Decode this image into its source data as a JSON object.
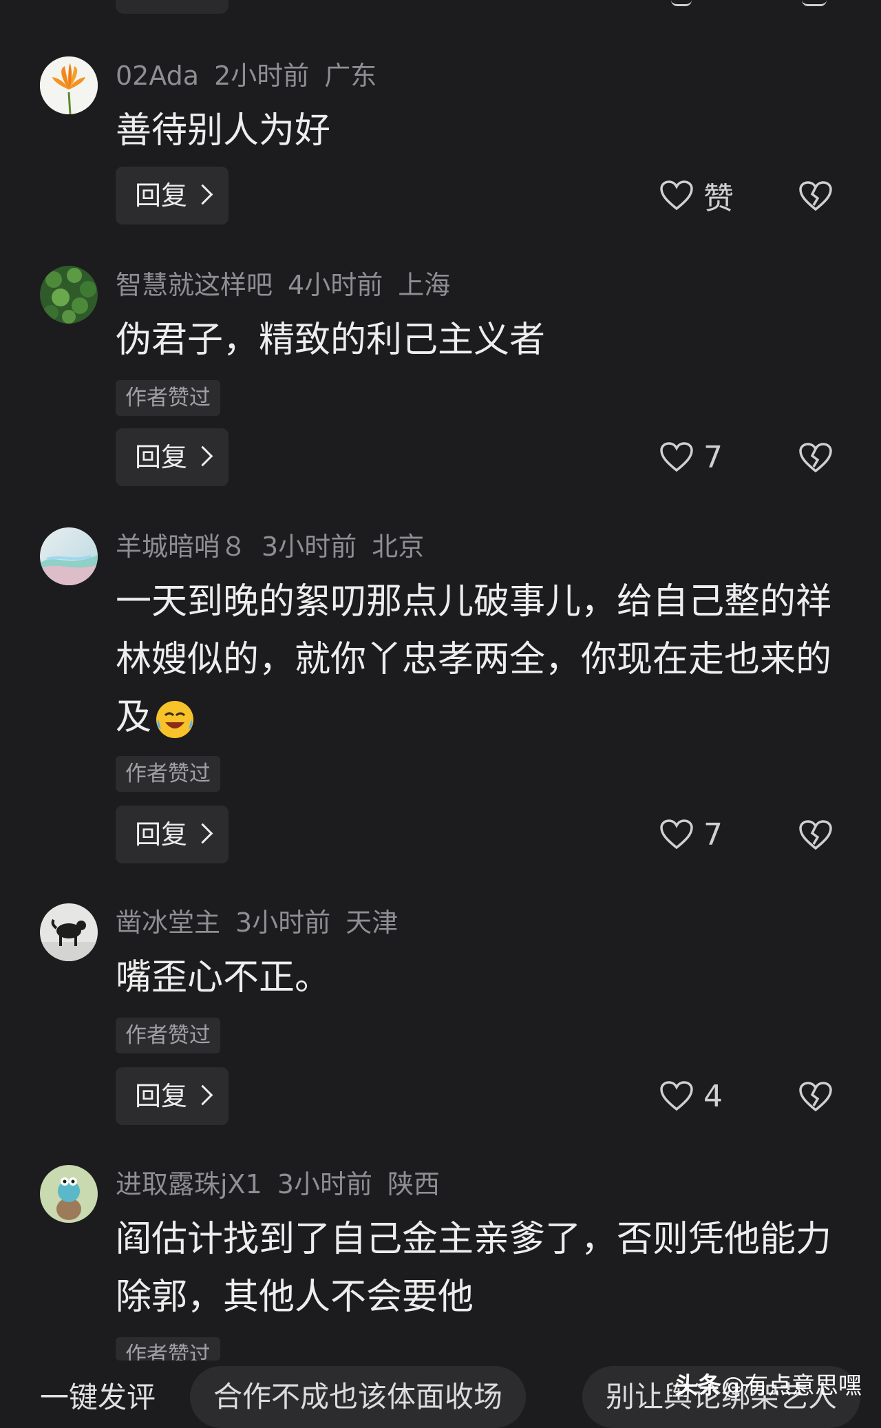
{
  "comments": [
    {
      "user": "02Ada",
      "time": "2小时前",
      "region": "广东",
      "text": "善待别人为好",
      "author_liked": "",
      "like": "赞",
      "reply": "回复"
    },
    {
      "user": "智慧就这样吧",
      "time": "4小时前",
      "region": "上海",
      "text": "伪君子，精致的利己主义者",
      "author_liked": "作者赞过",
      "like": "7",
      "reply": "回复"
    },
    {
      "user": "羊城暗哨８",
      "time": "3小时前",
      "region": "北京",
      "text": "一天到晚的絮叨那点儿破事儿，给自己整的祥林嫂似的，就你丫忠孝两全，你现在走也来的及",
      "author_liked": "作者赞过",
      "like": "7",
      "reply": "回复"
    },
    {
      "user": "凿冰堂主",
      "time": "3小时前",
      "region": "天津",
      "text": "嘴歪心不正。",
      "author_liked": "作者赞过",
      "like": "4",
      "reply": "回复"
    },
    {
      "user": "进取露珠jX1",
      "time": "3小时前",
      "region": "陕西",
      "text": "阎估计找到了自己金主亲爹了，否则凭他能力除郭，其他人不会要他",
      "author_liked": "作者赞过",
      "like": "",
      "reply": ""
    }
  ],
  "bottom": {
    "quick_label": "一键发评",
    "chip1": "合作不成也该体面收场",
    "chip2": "别让舆论绑架艺人",
    "watermark_brand": "头条",
    "watermark_handle": "@有点意思嘿"
  },
  "colors": {
    "background": "#1c1c1e",
    "muted": "#8e8e93",
    "chip": "#2c2c2e"
  }
}
